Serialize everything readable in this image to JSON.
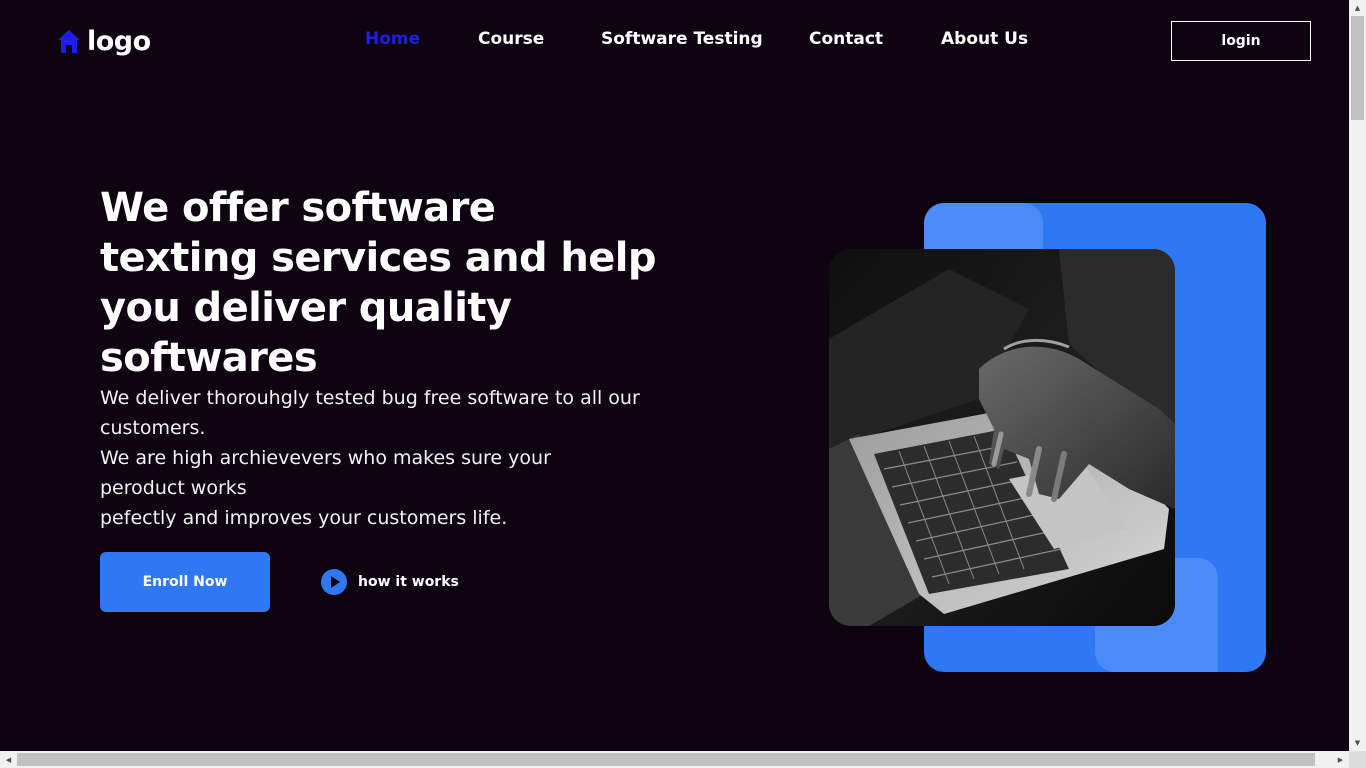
{
  "header": {
    "logo_text": "logo",
    "logo_icon": "home-icon",
    "nav": [
      {
        "label": "Home",
        "active": true
      },
      {
        "label": "Course",
        "active": false
      },
      {
        "label": "Software Testing",
        "active": false
      },
      {
        "label": "Contact",
        "active": false
      },
      {
        "label": "About Us",
        "active": false
      }
    ],
    "login_label": "login"
  },
  "hero": {
    "title": "We offer software texting services and help you deliver quality softwares",
    "description_lines": [
      "We deliver thorouhgly tested bug free software to all our customers.",
      "We are high archievevers who makes sure your peroduct works",
      "pefectly and improves your customers life."
    ],
    "enroll_label": "Enroll Now",
    "how_label": "how it works",
    "how_icon": "play-icon"
  },
  "colors": {
    "background": "#0e0311",
    "accent": "#2f78f4",
    "accent_light": "#4a8bf6",
    "nav_active": "#1f1ee8"
  }
}
